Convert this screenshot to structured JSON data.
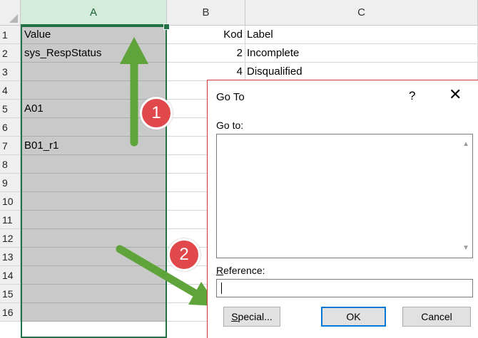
{
  "columns": [
    {
      "label": "A",
      "selected": true
    },
    {
      "label": "B",
      "selected": false
    },
    {
      "label": "C",
      "selected": false
    }
  ],
  "rows": [
    {
      "num": "1",
      "a": "Value",
      "b": "Kod",
      "c": "Label"
    },
    {
      "num": "2",
      "a": "sys_RespStatus",
      "b": "2",
      "c": "Incomplete"
    },
    {
      "num": "3",
      "a": "",
      "b": "4",
      "c": "Disqualified"
    },
    {
      "num": "4",
      "a": "",
      "b": "",
      "c": ""
    },
    {
      "num": "5",
      "a": "A01",
      "b": "",
      "c": ""
    },
    {
      "num": "6",
      "a": "",
      "b": "",
      "c": ""
    },
    {
      "num": "7",
      "a": "B01_r1",
      "b": "",
      "c": ""
    },
    {
      "num": "8",
      "a": "",
      "b": "",
      "c": ""
    },
    {
      "num": "9",
      "a": "",
      "b": "",
      "c": ""
    },
    {
      "num": "10",
      "a": "",
      "b": "",
      "c": ""
    },
    {
      "num": "11",
      "a": "",
      "b": "",
      "c": ""
    },
    {
      "num": "12",
      "a": "",
      "b": "",
      "c": ""
    },
    {
      "num": "13",
      "a": "",
      "b": "",
      "c": ""
    },
    {
      "num": "14",
      "a": "",
      "b": "",
      "c": ""
    },
    {
      "num": "15",
      "a": "",
      "b": "",
      "c": ""
    },
    {
      "num": "16",
      "a": "",
      "b": "",
      "c": ""
    }
  ],
  "dialog": {
    "title": "Go To",
    "help": "?",
    "close": "✕",
    "goto_label": "Go to:",
    "reference_label_first": "R",
    "reference_label_rest": "eference:",
    "reference_value": "",
    "special_first": "S",
    "special_rest": "pecial...",
    "ok_label": "OK",
    "cancel_label": "Cancel"
  },
  "annotations": {
    "step1": "1",
    "step2": "2",
    "arrow_color": "#5ea43a",
    "badge_color": "#e0484b"
  },
  "icons": {
    "scroll_up": "chevron-up-icon",
    "scroll_down": "chevron-down-icon",
    "close": "close-icon"
  }
}
